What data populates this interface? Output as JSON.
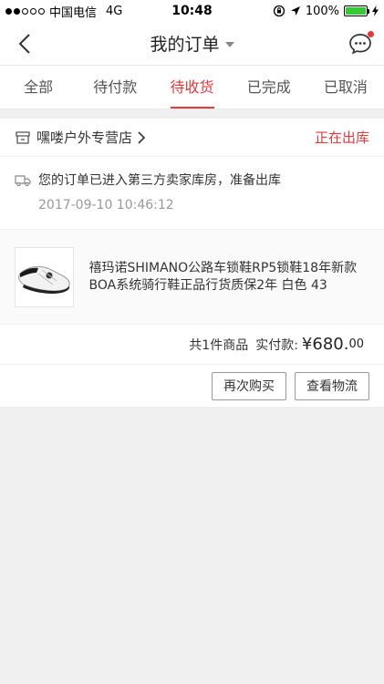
{
  "status_bar": {
    "carrier": "中国电信",
    "network": "4G",
    "time": "10:48",
    "battery": "100%",
    "battery_level": 1.0,
    "signal_bars_full": 2,
    "signal_bars_total": 5
  },
  "nav": {
    "title": "我的订单"
  },
  "tabs": [
    {
      "label": "全部",
      "active": false
    },
    {
      "label": "待付款",
      "active": false
    },
    {
      "label": "待收货",
      "active": true
    },
    {
      "label": "已完成",
      "active": false
    },
    {
      "label": "已取消",
      "active": false
    }
  ],
  "order": {
    "shop_name": "嘿喽户外专营店",
    "status": "正在出库",
    "logistics_message": "您的订单已进入第三方卖家库房，准备出库",
    "logistics_time": "2017-09-10 10:46:12",
    "product_title": "禧玛诺SHIMANO公路车锁鞋RP5锁鞋18年新款BOA系统骑行鞋正品行货质保2年 白色 43",
    "item_count_text": "共1件商品",
    "paid_label": "实付款:",
    "amount_main": "¥680.",
    "amount_cents": "00",
    "buttons": {
      "rebuy": "再次购买",
      "logistics": "查看物流"
    }
  },
  "colors": {
    "accent": "#e4393c",
    "battery": "#37c837",
    "background": "#f0f0f0"
  },
  "icons": [
    "back-arrow-icon",
    "message-icon",
    "shop-icon",
    "chevron-right-icon",
    "truck-icon",
    "location-arrow-icon",
    "rotation-lock-icon"
  ]
}
